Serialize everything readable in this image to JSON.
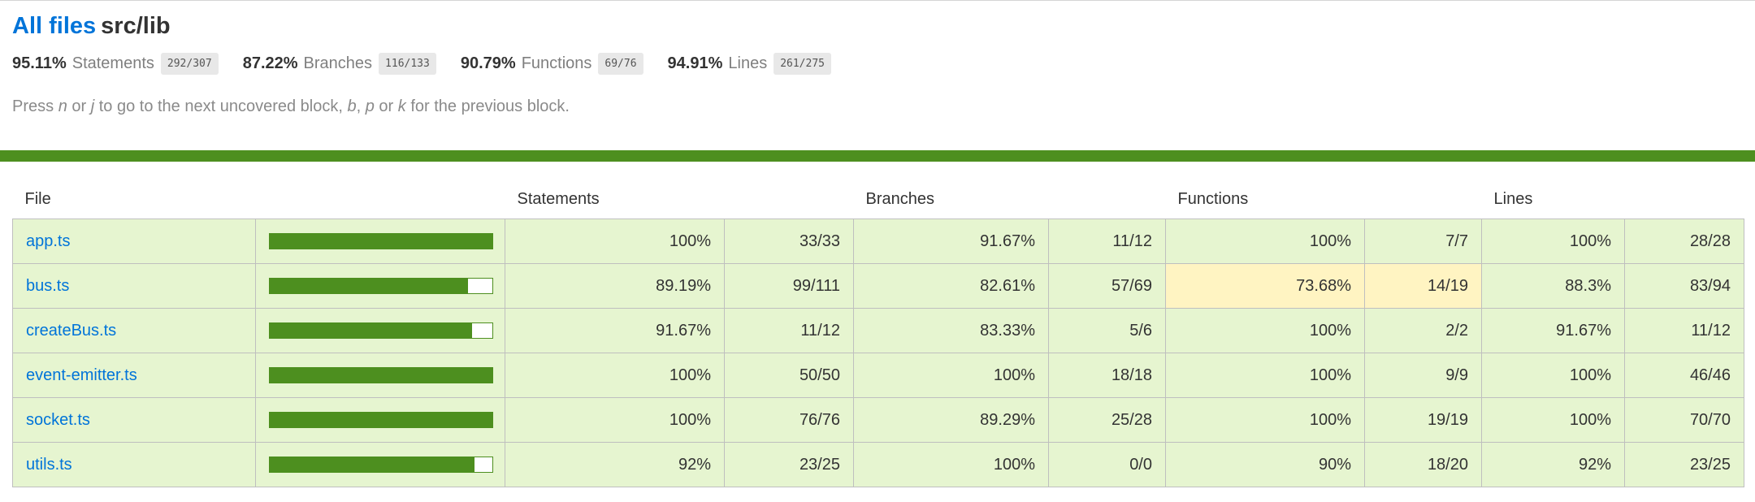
{
  "header": {
    "all_files_label": "All files",
    "path": "src/lib"
  },
  "summary": [
    {
      "pct": "95.11%",
      "label": "Statements",
      "frac": "292/307"
    },
    {
      "pct": "87.22%",
      "label": "Branches",
      "frac": "116/133"
    },
    {
      "pct": "90.79%",
      "label": "Functions",
      "frac": "69/76"
    },
    {
      "pct": "94.91%",
      "label": "Lines",
      "frac": "261/275"
    }
  ],
  "hint": {
    "p1": "Press ",
    "k1": "n",
    "p2": " or ",
    "k2": "j",
    "p3": " to go to the next uncovered block, ",
    "k3": "b",
    "p4": ", ",
    "k4": "p",
    "p5": " or ",
    "k5": "k",
    "p6": " for the previous block."
  },
  "table": {
    "columns": {
      "file": "File",
      "statements": "Statements",
      "branches": "Branches",
      "functions": "Functions",
      "lines": "Lines"
    },
    "rows": [
      {
        "file": "app.ts",
        "coverage": 100,
        "stmt_pct": "100%",
        "stmt_frac": "33/33",
        "br_pct": "91.67%",
        "br_frac": "11/12",
        "fn_pct": "100%",
        "fn_frac": "7/7",
        "ln_pct": "100%",
        "ln_frac": "28/28"
      },
      {
        "file": "bus.ts",
        "coverage": 89.19,
        "stmt_pct": "89.19%",
        "stmt_frac": "99/111",
        "br_pct": "82.61%",
        "br_frac": "57/69",
        "fn_pct": "73.68%",
        "fn_frac": "14/19",
        "ln_pct": "88.3%",
        "ln_frac": "83/94"
      },
      {
        "file": "createBus.ts",
        "coverage": 91.67,
        "stmt_pct": "91.67%",
        "stmt_frac": "11/12",
        "br_pct": "83.33%",
        "br_frac": "5/6",
        "fn_pct": "100%",
        "fn_frac": "2/2",
        "ln_pct": "91.67%",
        "ln_frac": "11/12"
      },
      {
        "file": "event-emitter.ts",
        "coverage": 100,
        "stmt_pct": "100%",
        "stmt_frac": "50/50",
        "br_pct": "100%",
        "br_frac": "18/18",
        "fn_pct": "100%",
        "fn_frac": "9/9",
        "ln_pct": "100%",
        "ln_frac": "46/46"
      },
      {
        "file": "socket.ts",
        "coverage": 100,
        "stmt_pct": "100%",
        "stmt_frac": "76/76",
        "br_pct": "89.29%",
        "br_frac": "25/28",
        "fn_pct": "100%",
        "fn_frac": "19/19",
        "ln_pct": "100%",
        "ln_frac": "70/70"
      },
      {
        "file": "utils.ts",
        "coverage": 92,
        "stmt_pct": "92%",
        "stmt_frac": "23/25",
        "br_pct": "100%",
        "br_frac": "0/0",
        "fn_pct": "90%",
        "fn_frac": "18/20",
        "ln_pct": "92%",
        "ln_frac": "23/25"
      }
    ]
  },
  "colors": {
    "link": "#0074d9",
    "high_bg": "#e6f5d0",
    "medium_bg": "#fff4c2",
    "bar_fill": "#4d8f1f"
  }
}
